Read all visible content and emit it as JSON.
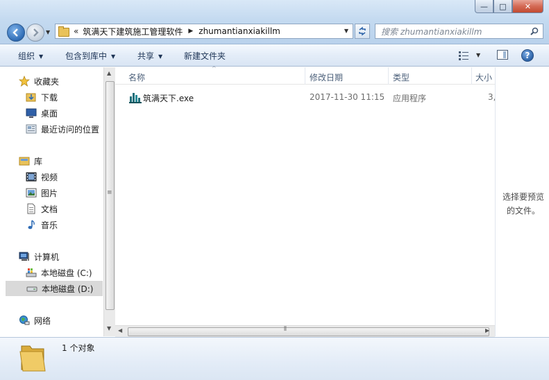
{
  "window": {
    "controls": {
      "minimize": "—",
      "maximize": "□",
      "close": "✕"
    }
  },
  "address_bar": {
    "overflow_marker": "«",
    "crumbs": [
      "筑满天下建筑施工管理软件",
      "zhumantianxiakillm"
    ],
    "search_placeholder": "搜索 zhumantianxiakillm"
  },
  "command_bar": {
    "organize": "组织",
    "include_in_library": "包含到库中",
    "share": "共享",
    "new_folder": "新建文件夹"
  },
  "navigation": {
    "favorites": {
      "label": "收藏夹",
      "items": [
        "下载",
        "桌面",
        "最近访问的位置"
      ]
    },
    "libraries": {
      "label": "库",
      "items": [
        "视频",
        "图片",
        "文档",
        "音乐"
      ]
    },
    "computer": {
      "label": "计算机",
      "items": [
        "本地磁盘 (C:)",
        "本地磁盘 (D:)"
      ],
      "selected": "本地磁盘 (D:)"
    },
    "network": {
      "label": "网络"
    }
  },
  "columns": {
    "name": "名称",
    "date_modified": "修改日期",
    "type": "类型",
    "size": "大小"
  },
  "files": [
    {
      "name": "筑满天下.exe",
      "date_modified": "2017-11-30 11:15",
      "type": "应用程序",
      "size": "3,"
    }
  ],
  "preview_pane": {
    "message_line1": "选择要预览",
    "message_line2": "的文件。"
  },
  "details_pane": {
    "item_count": "1 个对象"
  },
  "colors": {
    "accent": "#2f6cb5",
    "folder": "#e9c25a",
    "selection": "#d9d9d9"
  }
}
